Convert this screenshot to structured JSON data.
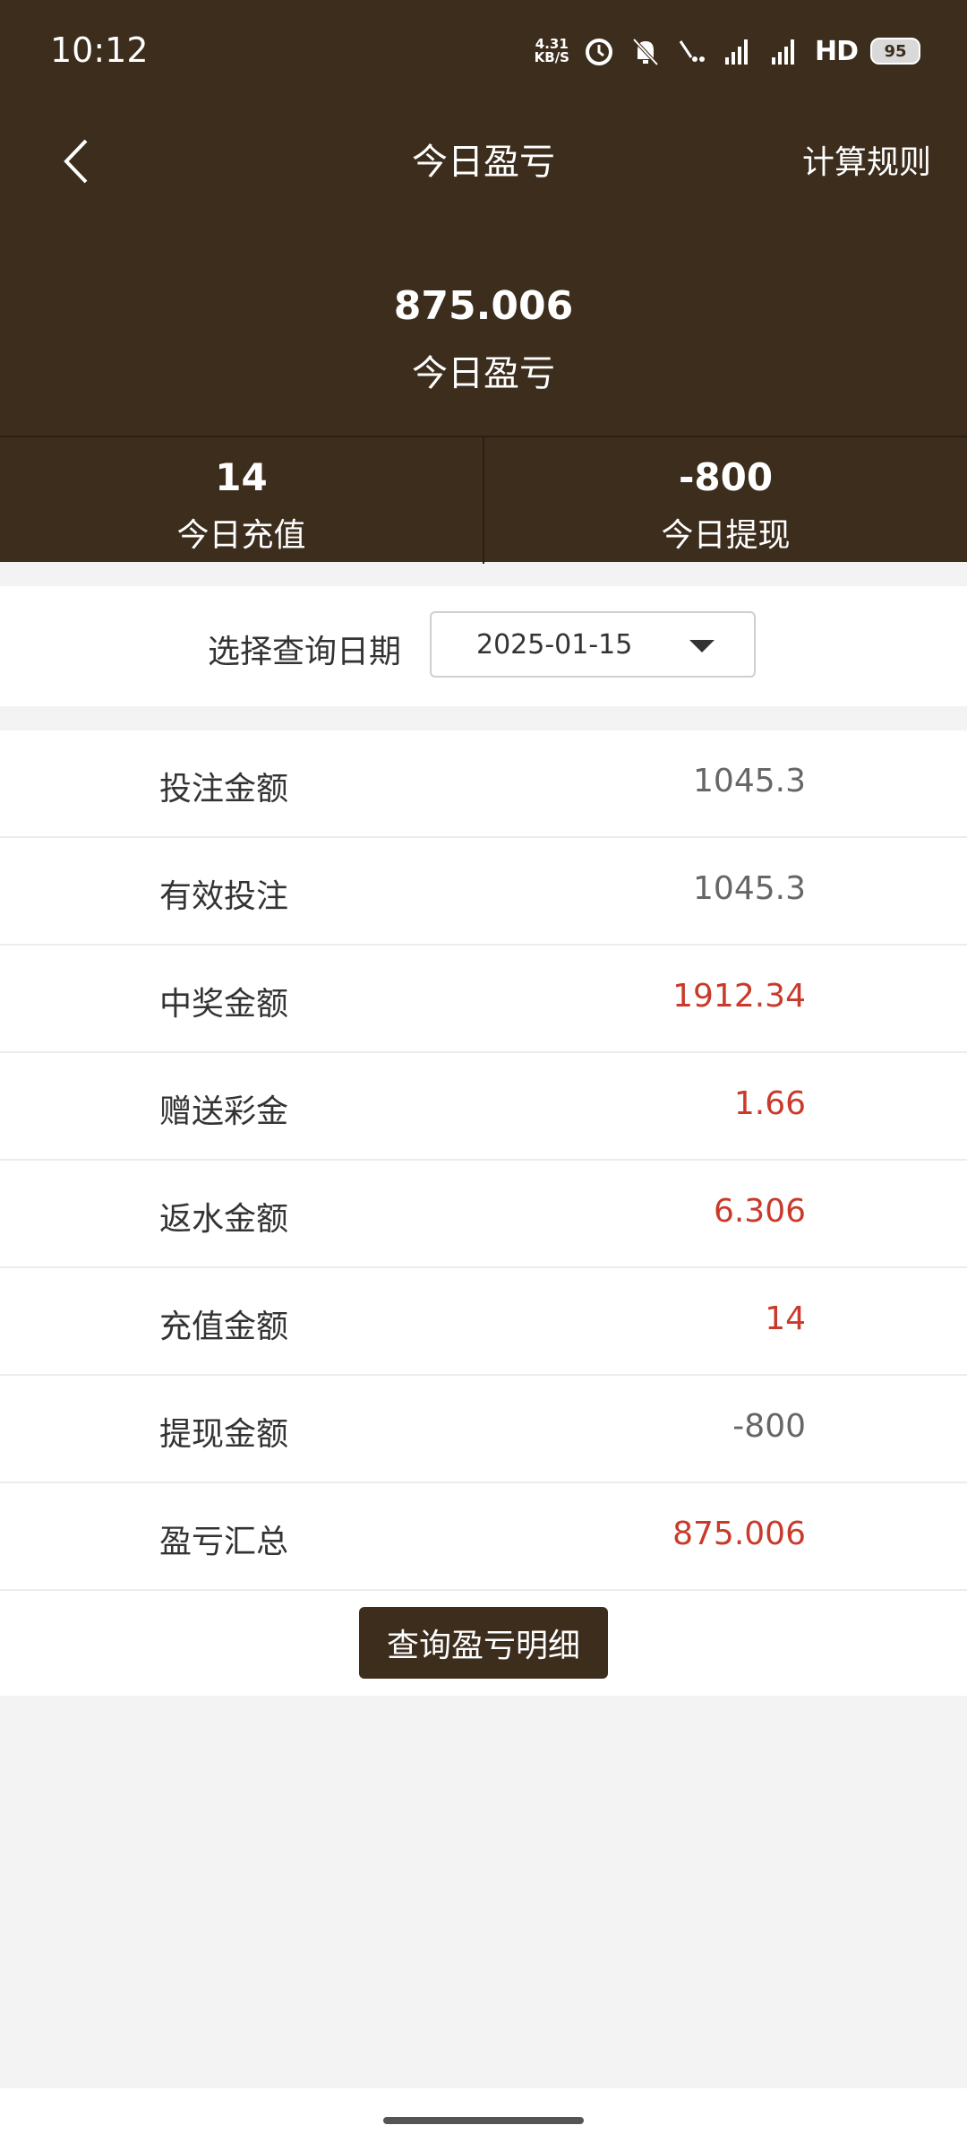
{
  "status_bar": {
    "time": "10:12",
    "net_speed_value": "4.31",
    "net_speed_unit": "KB/S",
    "hd_label": "HD",
    "battery": "95"
  },
  "nav": {
    "title": "今日盈亏",
    "rules_label": "计算规则"
  },
  "summary": {
    "profit_value": "875.006",
    "profit_label": "今日盈亏",
    "recharge_value": "14",
    "recharge_label": "今日充值",
    "withdraw_value": "-800",
    "withdraw_label": "今日提现"
  },
  "date_picker": {
    "label": "选择查询日期",
    "value": "2025-01-15"
  },
  "details": [
    {
      "label": "投注金额",
      "value": "1045.3",
      "highlight": false
    },
    {
      "label": "有效投注",
      "value": "1045.3",
      "highlight": false
    },
    {
      "label": "中奖金额",
      "value": "1912.34",
      "highlight": true
    },
    {
      "label": "赠送彩金",
      "value": "1.66",
      "highlight": true
    },
    {
      "label": "返水金额",
      "value": "6.306",
      "highlight": true
    },
    {
      "label": "充值金额",
      "value": "14",
      "highlight": true
    },
    {
      "label": "提现金额",
      "value": "-800",
      "highlight": false
    },
    {
      "label": "盈亏汇总",
      "value": "875.006",
      "highlight": true
    }
  ],
  "action": {
    "detail_button_label": "查询盈亏明细"
  },
  "colors": {
    "header_bg": "#3c2d1d",
    "highlight_red": "#c93a2b",
    "neutral_value": "#666666"
  }
}
